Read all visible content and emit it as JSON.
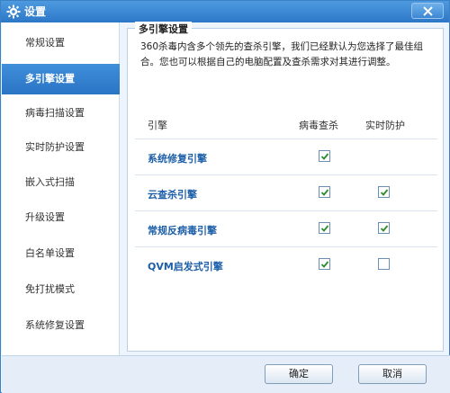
{
  "window": {
    "title": "设置",
    "title_icon": "gear-icon",
    "close_icon": "close-icon"
  },
  "sidebar": {
    "items": [
      {
        "label": "常规设置",
        "active": false
      },
      {
        "label": "多引擎设置",
        "active": true
      },
      {
        "label": "病毒扫描设置",
        "active": false
      },
      {
        "label": "实时防护设置",
        "active": false
      },
      {
        "label": "嵌入式扫描",
        "active": false
      },
      {
        "label": "升级设置",
        "active": false
      },
      {
        "label": "白名单设置",
        "active": false
      },
      {
        "label": "免打扰模式",
        "active": false
      },
      {
        "label": "系统修复设置",
        "active": false
      }
    ]
  },
  "panel": {
    "title": "多引擎设置",
    "description": "360杀毒内含多个领先的查杀引擎，我们已经默认为您选择了最佳组合。您也可以根据自己的电脑配置及查杀需求对其进行调整。",
    "columns": {
      "engine": "引擎",
      "virus_scan": "病毒查杀",
      "realtime": "实时防护"
    },
    "engines": [
      {
        "name": "系统修复引擎",
        "virus_scan": true,
        "realtime": null
      },
      {
        "name": "云查杀引擎",
        "virus_scan": true,
        "realtime": true
      },
      {
        "name": "常规反病毒引擎",
        "virus_scan": true,
        "realtime": true
      },
      {
        "name": "QVM启发式引擎",
        "virus_scan": true,
        "realtime": false
      }
    ]
  },
  "footer": {
    "ok_label": "确定",
    "cancel_label": "取消"
  },
  "colors": {
    "accent": "#2c78c8",
    "link": "#1d5fa8",
    "check": "#2e8b2e"
  }
}
